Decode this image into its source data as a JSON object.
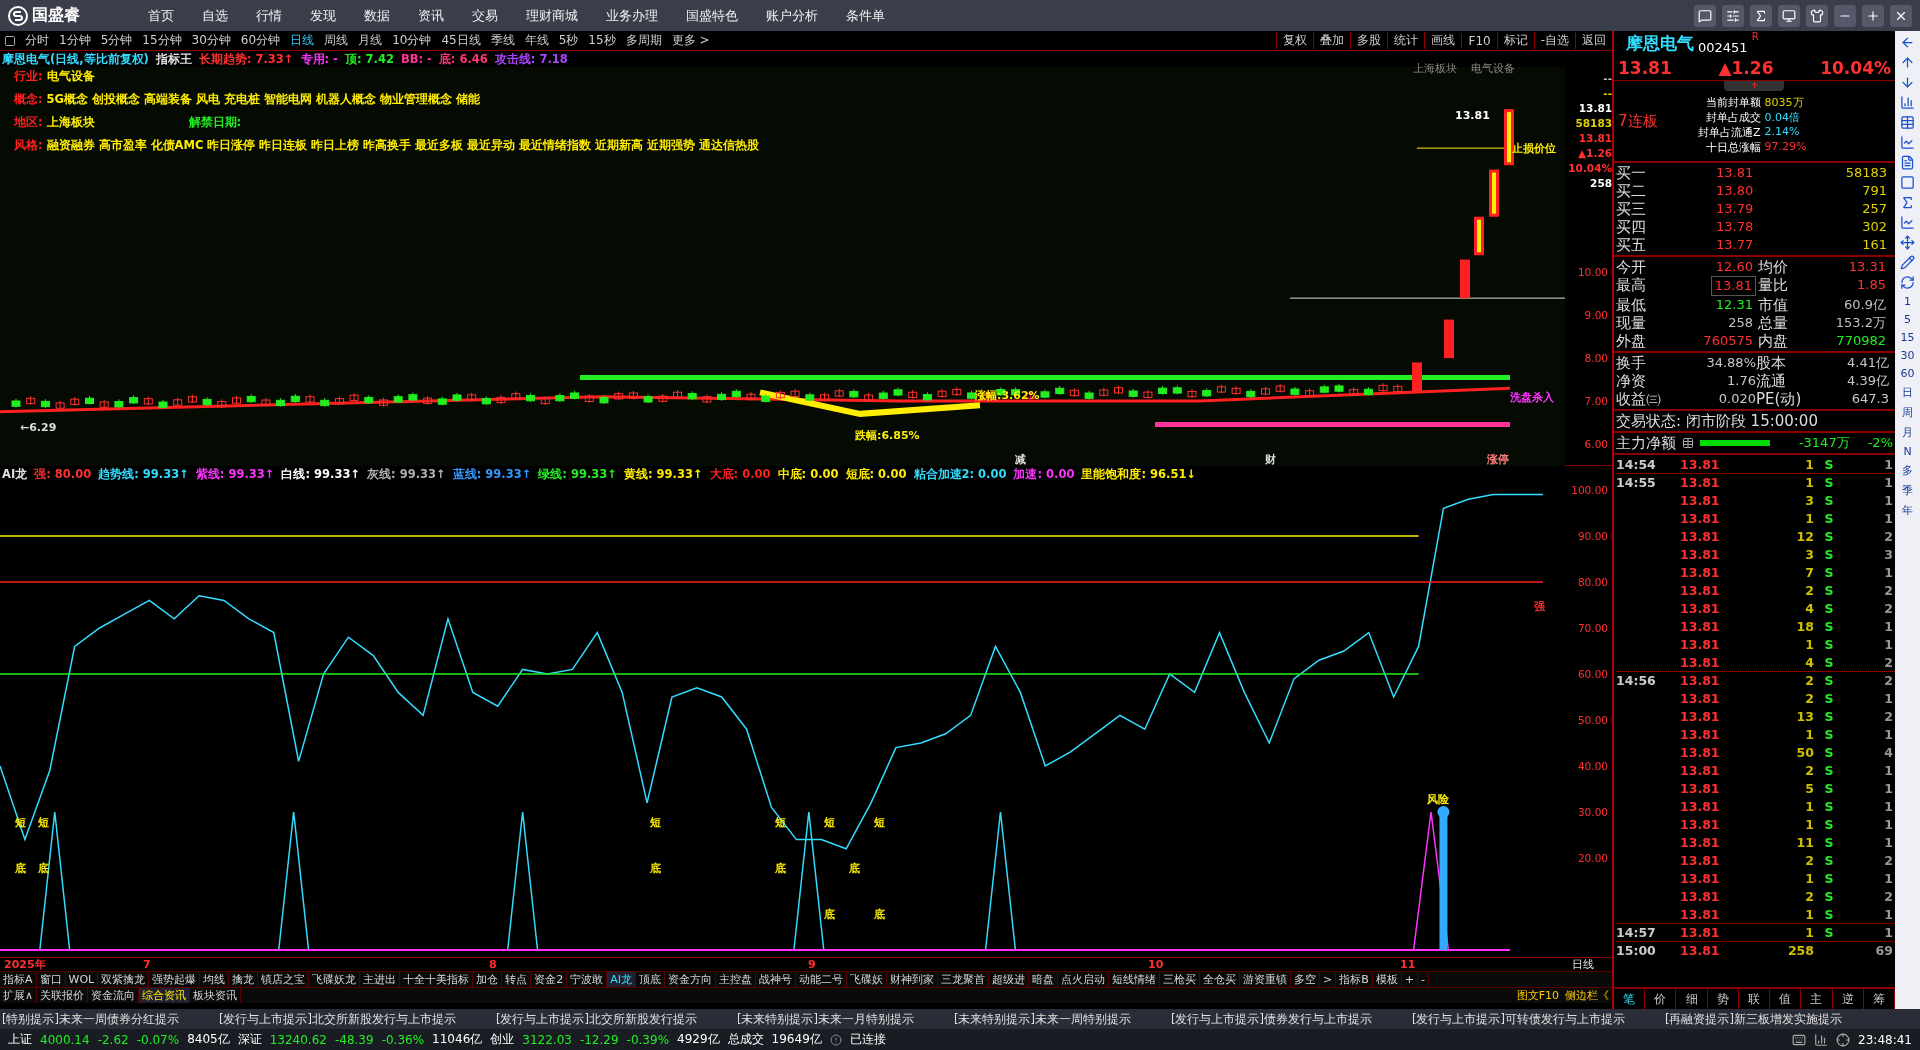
{
  "app": {
    "logo": "国盛睿",
    "menu": [
      {
        "label": "首页"
      },
      {
        "label": "自选"
      },
      {
        "label": "行情"
      },
      {
        "label": "发现"
      },
      {
        "label": "数据"
      },
      {
        "label": "资讯"
      },
      {
        "label": "交易"
      },
      {
        "label": "理财商城"
      },
      {
        "label": "业务办理"
      },
      {
        "label": "国盛特色"
      },
      {
        "label": "账户分析"
      },
      {
        "label": "条件单"
      }
    ]
  },
  "periods": [
    {
      "label": "分时",
      "selected": false
    },
    {
      "label": "1分钟",
      "selected": false
    },
    {
      "label": "5分钟",
      "selected": false
    },
    {
      "label": "15分钟",
      "selected": false
    },
    {
      "label": "30分钟",
      "selected": false
    },
    {
      "label": "60分钟",
      "selected": false
    },
    {
      "label": "日线",
      "selected": true
    },
    {
      "label": "周线",
      "selected": false
    },
    {
      "label": "月线",
      "selected": false
    },
    {
      "label": "10分钟",
      "selected": false
    },
    {
      "label": "45日线",
      "selected": false
    },
    {
      "label": "季线",
      "selected": false
    },
    {
      "label": "年线",
      "selected": false
    },
    {
      "label": "5秒",
      "selected": false
    },
    {
      "label": "15秒",
      "selected": false
    },
    {
      "label": "多周期",
      "selected": false
    },
    {
      "label": "更多 >",
      "selected": false
    }
  ],
  "chart_tools": [
    "复权",
    "叠加",
    "多股",
    "统计",
    "画线",
    "F10",
    "标记",
    "-自选",
    "返回"
  ],
  "kline": {
    "legend": [
      {
        "label": "摩恩电气(日线,等比前复权)",
        "color": "#33ddff"
      },
      {
        "label": "指标王",
        "color": "#e0e0e0"
      },
      {
        "label": "长期趋势: 7.33↑",
        "color": "#ff3030"
      },
      {
        "label": "专用: -",
        "color": "#ff33ff"
      },
      {
        "label": "顶: 7.42",
        "color": "#22ee22"
      },
      {
        "label": "BB: -",
        "color": "#ff3399"
      },
      {
        "label": "底: 6.46",
        "color": "#ff3377"
      },
      {
        "label": "攻击线: 7.18",
        "color": "#aa44ff"
      }
    ],
    "info": [
      {
        "label": "行业:",
        "value": "电气设备",
        "kind": "plain"
      },
      {
        "label": "概念:",
        "value": "5G概念 创投概念 高端装备 风电 充电桩 智能电网 机器人概念 物业管理概念 储能",
        "kind": "plain"
      },
      {
        "label": "地区:",
        "value": "上海板块",
        "kind": "split",
        "extra": "解禁日期:"
      },
      {
        "label": "风格:",
        "value": "融资融券 高市盈率 化债AMC 昨日涨停 昨日连板 昨日上榜 昨高换手 最近多板 最近异动 最近情绪指数 近期新高 近期强势 通达信热股",
        "kind": "plain"
      }
    ],
    "sectors": [
      "上海板块",
      "电气设备"
    ],
    "annotations": [
      "13.81",
      "止损价位",
      "←6.29",
      "跌幅:6.85%",
      "涨幅:3.62%",
      "洗盘杀入",
      "减",
      "财",
      "涨停"
    ],
    "axis_top": [
      {
        "label": "--",
        "color": "#c0c0c0"
      },
      {
        "label": "--",
        "color": "#e0d000"
      },
      {
        "label": "13.81",
        "color": "#ffffff"
      },
      {
        "label": "58183",
        "color": "#e0d000"
      },
      {
        "label": "13.81",
        "color": "#ff3030"
      },
      {
        "label": "▲1.26",
        "color": "#ff3030"
      },
      {
        "label": "10.04%",
        "color": "#ff3030"
      },
      {
        "label": "258",
        "color": "#ffffff"
      }
    ],
    "axis_ticks": [
      "10.00",
      "9.00",
      "8.00",
      "7.00",
      "6.00"
    ]
  },
  "indicator": {
    "legend": [
      {
        "label": "AI龙",
        "color": "#e0e0e0"
      },
      {
        "label": "强: 80.00",
        "color": "#ff3030"
      },
      {
        "label": "趋势线: 99.33↑",
        "color": "#33ddff"
      },
      {
        "label": "紫线: 99.33↑",
        "color": "#ff33ff"
      },
      {
        "label": "白线: 99.33↑",
        "color": "#ffffff"
      },
      {
        "label": "灰线: 99.33↑",
        "color": "#b0b0b0"
      },
      {
        "label": "蓝线: 99.33↑",
        "color": "#3399ff"
      },
      {
        "label": "绿线: 99.33↑",
        "color": "#22ee22"
      },
      {
        "label": "黄线: 99.33↑",
        "color": "#ffee00"
      },
      {
        "label": "大底: 0.00",
        "color": "#ff2020"
      },
      {
        "label": "中底: 0.00",
        "color": "#ffee00"
      },
      {
        "label": "短底: 0.00",
        "color": "#ffee00"
      },
      {
        "label": "粘合加速2: 0.00",
        "color": "#33ddff"
      },
      {
        "label": "加速: 0.00",
        "color": "#ff33ff"
      },
      {
        "label": "里能饱和度: 96.51↓",
        "color": "#ffee00"
      }
    ],
    "chart_data": {
      "type": "line",
      "series": [
        {
          "color": "#33ddff",
          "values": [
            40,
            24,
            39,
            66,
            70,
            73,
            76,
            72,
            77,
            76,
            72,
            69,
            41,
            60,
            68,
            64,
            56,
            51,
            72,
            56,
            53,
            61,
            60,
            61,
            69,
            56,
            32,
            55,
            57,
            55,
            48,
            31,
            24,
            24,
            22,
            32,
            44,
            45,
            47,
            51,
            66,
            56,
            40,
            43,
            47,
            51,
            48,
            60,
            56,
            69,
            56,
            45,
            59,
            63,
            65,
            69,
            55,
            66,
            96,
            98,
            99,
            99,
            99
          ]
        },
        {
          "color": "#ffee00",
          "values": [
            90,
            90,
            90,
            90,
            90,
            90,
            90,
            90,
            90,
            90,
            90,
            90,
            90,
            90,
            90,
            90,
            90,
            90,
            90,
            90,
            90,
            90,
            90,
            90,
            90,
            90,
            90,
            90,
            90,
            90,
            90,
            90,
            90,
            90,
            90,
            90,
            90,
            90,
            90,
            90,
            90,
            90,
            90,
            90,
            90,
            90,
            90,
            90,
            90,
            90,
            90,
            90,
            90,
            90,
            90,
            90,
            90,
            90,
            null,
            null,
            null,
            null,
            null
          ]
        },
        {
          "color": "#ff2020",
          "values": [
            80,
            80,
            80,
            80,
            80,
            80,
            80,
            80,
            80,
            80,
            80,
            80,
            80,
            80,
            80,
            80,
            80,
            80,
            80,
            80,
            80,
            80,
            80,
            80,
            80,
            80,
            80,
            80,
            80,
            80,
            80,
            80,
            80,
            80,
            80,
            80,
            80,
            80,
            80,
            80,
            80,
            80,
            80,
            80,
            80,
            80,
            80,
            80,
            80,
            80,
            80,
            80,
            80,
            80,
            80,
            80,
            80,
            80,
            80,
            80,
            80,
            80,
            80
          ]
        },
        {
          "color": "#33aaff",
          "marker": "o",
          "values": [
            null,
            null,
            null,
            null,
            null,
            null,
            null,
            null,
            null,
            null,
            null,
            null,
            null,
            null,
            null,
            null,
            null,
            null,
            null,
            null,
            null,
            null,
            null,
            null,
            null,
            null,
            null,
            null,
            null,
            null,
            null,
            null,
            null,
            null,
            null,
            null,
            null,
            null,
            null,
            null,
            null,
            null,
            null,
            null,
            null,
            null,
            null,
            null,
            null,
            null,
            null,
            null,
            null,
            null,
            null,
            null,
            null,
            null,
            30,
            null,
            null,
            null,
            null
          ]
        },
        {
          "color": "#22ee22",
          "values": [
            60,
            60,
            60,
            60,
            60,
            60,
            60,
            60,
            60,
            60,
            60,
            60,
            60,
            60,
            60,
            60,
            60,
            60,
            60,
            60,
            60,
            60,
            60,
            60,
            60,
            60,
            60,
            60,
            60,
            60,
            60,
            60,
            60,
            60,
            60,
            60,
            60,
            60,
            60,
            60,
            60,
            60,
            60,
            60,
            60,
            60,
            60,
            60,
            60,
            60,
            60,
            60,
            60,
            60,
            60,
            60,
            60,
            60,
            null,
            null,
            null,
            null,
            null
          ]
        }
      ],
      "ylim": [
        0,
        100
      ],
      "yticks": [
        {
          "value": 100,
          "label": "100.00"
        },
        {
          "value": 90,
          "label": "90.00"
        },
        {
          "value": 80,
          "label": "80.00"
        },
        {
          "value": 70,
          "label": "70.00"
        },
        {
          "value": 60,
          "label": "60.00"
        },
        {
          "value": 50,
          "label": "50.00"
        },
        {
          "value": 40,
          "label": "40.00"
        },
        {
          "value": 30,
          "label": "30.00"
        },
        {
          "value": 20,
          "label": "20.00"
        }
      ],
      "annotations": [
        "短",
        "短",
        "底",
        "底",
        "短",
        "底",
        "短",
        "短",
        "短",
        "底",
        "底",
        "底",
        "底",
        "风险",
        "强"
      ]
    }
  },
  "xaxis": [
    "2025年",
    "7",
    "8",
    "9",
    "10",
    "11"
  ],
  "period_label": "日线",
  "indicator_tabs": [
    {
      "label": "指标A",
      "selected": false
    },
    {
      "label": "窗口",
      "selected": false
    },
    {
      "label": "WOL",
      "selected": false
    },
    {
      "label": "双紫擒龙",
      "selected": false
    },
    {
      "label": "强势起爆",
      "selected": false
    },
    {
      "label": "均线",
      "selected": false
    },
    {
      "label": "擒龙",
      "selected": false
    },
    {
      "label": "镇店之宝",
      "selected": false
    },
    {
      "label": "飞碟妖龙",
      "selected": false
    },
    {
      "label": "主进出",
      "selected": false
    },
    {
      "label": "十全十美指标",
      "selected": false
    },
    {
      "label": "加仓",
      "selected": false
    },
    {
      "label": "转点",
      "selected": false
    },
    {
      "label": "资金2",
      "selected": false
    },
    {
      "label": "宁波敢",
      "selected": false
    },
    {
      "label": "AI龙",
      "selected": true
    },
    {
      "label": "顶底",
      "selected": false
    },
    {
      "label": "资金方向",
      "selected": false
    },
    {
      "label": "主控盘",
      "selected": false
    },
    {
      "label": "战神号",
      "selected": false
    },
    {
      "label": "动能二号",
      "selected": false
    },
    {
      "label": "飞碟妖",
      "selected": false
    },
    {
      "label": "财神到家",
      "selected": false
    },
    {
      "label": "三龙聚首",
      "selected": false
    },
    {
      "label": "超级进",
      "selected": false
    },
    {
      "label": "暗盘",
      "selected": false
    },
    {
      "label": "点火启动",
      "selected": false
    },
    {
      "label": "短线情绪",
      "selected": false
    },
    {
      "label": "三枪买",
      "selected": false
    },
    {
      "label": "全仓买",
      "selected": false
    },
    {
      "label": "游资重镇",
      "selected": false
    },
    {
      "label": "多空",
      "selected": false
    },
    {
      "label": ">",
      "selected": false
    },
    {
      "label": "指标B",
      "selected": false
    },
    {
      "label": "模板",
      "selected": false
    },
    {
      "label": "+",
      "selected": false
    },
    {
      "label": "-",
      "selected": false
    }
  ],
  "info_tabs": [
    {
      "label": "扩展∧",
      "selected": false
    },
    {
      "label": "关联报价",
      "selected": false
    },
    {
      "label": "资金流向",
      "selected": false
    },
    {
      "label": "综合资讯",
      "selected": true
    },
    {
      "label": "板块资讯",
      "selected": false
    }
  ],
  "info_tabs_right": [
    "图文F10",
    "侧边栏《"
  ],
  "quote": {
    "name": "摩恩电气",
    "code": "002451",
    "flag": "R",
    "price": "13.81",
    "change": "▲1.26",
    "pct": "10.04%",
    "streak": "7连板",
    "seal": [
      {
        "label": "当前封单额",
        "value": "8035万",
        "color": "#e0d000"
      },
      {
        "label": "封单占成交",
        "value": "0.04倍",
        "color": "#33ddff"
      },
      {
        "label": "封单占流通Z",
        "value": "2.14%",
        "color": "#33ddff"
      },
      {
        "label": "十日总涨幅",
        "value": "97.29%",
        "color": "#ff3030"
      }
    ],
    "bids": [
      {
        "label": "买一",
        "price": "13.81",
        "volume": "58183"
      },
      {
        "label": "买二",
        "price": "13.80",
        "volume": "791"
      },
      {
        "label": "买三",
        "price": "13.79",
        "volume": "257"
      },
      {
        "label": "买四",
        "price": "13.78",
        "volume": "302"
      },
      {
        "label": "买五",
        "price": "13.77",
        "volume": "161"
      }
    ],
    "stats": [
      {
        "label": "今开",
        "value": "12.60",
        "color": "#ff3030",
        "boxed": false
      },
      {
        "label": "均价",
        "value": "13.31",
        "color": "#ff3030",
        "boxed": false
      },
      {
        "label": "最高",
        "value": "13.81",
        "color": "#ff3030",
        "boxed": true
      },
      {
        "label": "量比",
        "value": "1.85",
        "color": "#ff3030",
        "boxed": false
      },
      {
        "label": "最低",
        "value": "12.31",
        "color": "#22ee22",
        "boxed": false
      },
      {
        "label": "市值",
        "value": "60.9亿",
        "color": "#c0c0c0",
        "boxed": false
      },
      {
        "label": "现量",
        "value": "258",
        "color": "#c0c0c0",
        "boxed": false
      },
      {
        "label": "总量",
        "value": "153.2万",
        "color": "#c0c0c0",
        "boxed": false
      },
      {
        "label": "外盘",
        "value": "760575",
        "color": "#ff3030",
        "boxed": false
      },
      {
        "label": "内盘",
        "value": "770982",
        "color": "#22ee22",
        "boxed": false
      }
    ],
    "stats2": [
      {
        "label": "换手",
        "value": "34.88%"
      },
      {
        "label": "股本",
        "value": "4.41亿"
      },
      {
        "label": "净资",
        "value": "1.76"
      },
      {
        "label": "流通",
        "value": "4.39亿"
      },
      {
        "label": "收益㈢",
        "value": "0.020"
      },
      {
        "label": "PE(动)",
        "value": "647.3"
      }
    ],
    "status": "交易状态: 闭市阶段 15:00:00",
    "flow_label": "主力净额",
    "flow_value": "-3147万",
    "flow_pct": "-2%",
    "ticks": [
      {
        "time": "14:54",
        "price": "13.81",
        "volume": "1",
        "side": "S",
        "count": "1"
      },
      {
        "time": "14:55",
        "price": "13.81",
        "volume": "1",
        "side": "S",
        "count": "1"
      },
      {
        "price": "13.81",
        "volume": "3",
        "side": "S",
        "count": "1"
      },
      {
        "price": "13.81",
        "volume": "1",
        "side": "S",
        "count": "1"
      },
      {
        "price": "13.81",
        "volume": "12",
        "side": "S",
        "count": "2"
      },
      {
        "price": "13.81",
        "volume": "3",
        "side": "S",
        "count": "3"
      },
      {
        "price": "13.81",
        "volume": "7",
        "side": "S",
        "count": "1"
      },
      {
        "price": "13.81",
        "volume": "2",
        "side": "S",
        "count": "2"
      },
      {
        "price": "13.81",
        "volume": "4",
        "side": "S",
        "count": "2"
      },
      {
        "price": "13.81",
        "volume": "18",
        "side": "S",
        "count": "1"
      },
      {
        "price": "13.81",
        "volume": "1",
        "side": "S",
        "count": "1"
      },
      {
        "price": "13.81",
        "volume": "4",
        "side": "S",
        "count": "2"
      },
      {
        "time": "14:56",
        "price": "13.81",
        "volume": "2",
        "side": "S",
        "count": "2"
      },
      {
        "price": "13.81",
        "volume": "2",
        "side": "S",
        "count": "1"
      },
      {
        "price": "13.81",
        "volume": "13",
        "side": "S",
        "count": "2"
      },
      {
        "price": "13.81",
        "volume": "1",
        "side": "S",
        "count": "1"
      },
      {
        "price": "13.81",
        "volume": "50",
        "side": "S",
        "count": "4"
      },
      {
        "price": "13.81",
        "volume": "2",
        "side": "S",
        "count": "1"
      },
      {
        "price": "13.81",
        "volume": "5",
        "side": "S",
        "count": "1"
      },
      {
        "price": "13.81",
        "volume": "1",
        "side": "S",
        "count": "1"
      },
      {
        "price": "13.81",
        "volume": "1",
        "side": "S",
        "count": "1"
      },
      {
        "price": "13.81",
        "volume": "11",
        "side": "S",
        "count": "1"
      },
      {
        "price": "13.81",
        "volume": "2",
        "side": "S",
        "count": "2"
      },
      {
        "price": "13.81",
        "volume": "1",
        "side": "S",
        "count": "1"
      },
      {
        "price": "13.81",
        "volume": "2",
        "side": "S",
        "count": "2"
      },
      {
        "price": "13.81",
        "volume": "1",
        "side": "S",
        "count": "1"
      },
      {
        "time": "14:57",
        "price": "13.81",
        "volume": "1",
        "side": "S",
        "count": "1"
      },
      {
        "time": "15:00",
        "price": "13.81",
        "volume": "258",
        "count": "69"
      }
    ],
    "tabs": [
      {
        "label": "笔",
        "selected": true
      },
      {
        "label": "价",
        "selected": false
      },
      {
        "label": "细",
        "selected": false
      },
      {
        "label": "势",
        "selected": false
      },
      {
        "label": "联",
        "selected": false
      },
      {
        "label": "值",
        "selected": false
      },
      {
        "label": "主",
        "selected": false
      },
      {
        "label": "逆",
        "selected": false
      },
      {
        "label": "筹",
        "selected": false
      }
    ]
  },
  "sidebar": {
    "periods": [
      "1",
      "5",
      "15",
      "30",
      "60",
      "日",
      "周",
      "月",
      "N",
      "多",
      "季",
      "年"
    ]
  },
  "ticker": [
    "[特别提示]未来一周债券分红提示",
    "[发行与上市提示]北交所新股发行与上市提示",
    "[发行与上市提示]北交所新股发行提示",
    "[未来特别提示]未来一月特别提示",
    "[未来特别提示]未来一周特别提示",
    "[发行与上市提示]债券发行与上市提示",
    "[发行与上市提示]可转债发行与上市提示",
    "[再融资提示]新三板增发实施提示"
  ],
  "status_bar": {
    "indices": [
      {
        "name": "上证",
        "value": "4000.14",
        "change": "-2.62",
        "pct": "-0.07%",
        "amount": "8405亿"
      },
      {
        "name": "深证",
        "value": "13240.62",
        "change": "-48.39",
        "pct": "-0.36%",
        "amount": "11046亿"
      },
      {
        "name": "创业",
        "value": "3122.03",
        "change": "-12.29",
        "pct": "-0.39%",
        "amount": "4929亿"
      }
    ],
    "total_label": "总成交",
    "total": "19649亿",
    "connection": "已连接",
    "time": "23:48:41"
  }
}
